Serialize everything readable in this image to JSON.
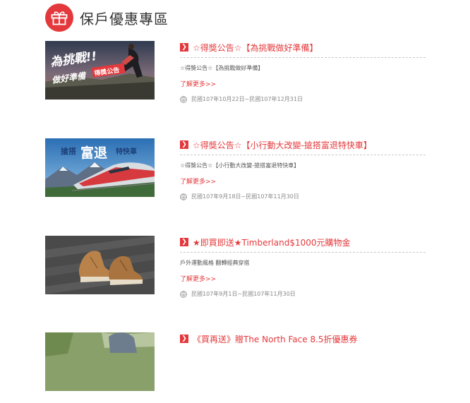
{
  "page": {
    "title": "保戶優惠專區",
    "icon": "gift-icon",
    "accent_color": "#e4393c"
  },
  "promotions": [
    {
      "title": "☆得獎公告☆【為挑戰做好準備】",
      "description": "☆得獎公告☆【為挑戰做好準備】",
      "more_label": "了解更多>>",
      "date_range": "民國107年10月22日~民國107年12月31日",
      "image": {
        "headline": "為挑戰!!",
        "subline": "做好準備",
        "badge": "得獎公告"
      }
    },
    {
      "title": "☆得獎公告☆【小行動大改變-搶搭富退特快車】",
      "description": "☆得獎公告☆【小行動大改變-搶搭富退特快車】",
      "more_label": "了解更多>>",
      "date_range": "民國107年9月18日~民國107年11月30日",
      "image": {
        "prefix": "搶搭",
        "emphasis": "富退",
        "suffix": "特快車"
      }
    },
    {
      "title": "★即買即送★Timberland$1000元購物金",
      "description": "戶外運動風格 翻轉經典穿搭",
      "more_label": "了解更多>>",
      "date_range": "民國107年9月1日~民國107年11月30日"
    },
    {
      "title": "《買再送》贈The North Face 8.5折優惠券"
    }
  ]
}
